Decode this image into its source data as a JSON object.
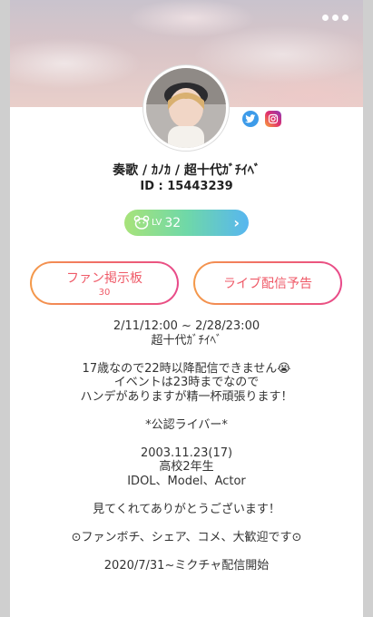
{
  "profile": {
    "name": "奏歌 / ｶﾉｶ / 超十代ｶﾞﾁｲﾍﾞ",
    "id_text": "ID : 15443239",
    "level_prefix": "LV",
    "level_value": "32"
  },
  "buttons": {
    "fan_board_label": "ファン掲示板",
    "fan_board_count": "30",
    "live_schedule_label": "ライブ配信予告"
  },
  "bio_lines": [
    "2/11/12:00 ~ 2/28/23:00",
    "超十代ｶﾞﾁｲﾍﾞ",
    "",
    "17歳なので22時以降配信できません😭",
    "イベントは23時までなので",
    "ハンデがありますが精一杯頑張ります！",
    "",
    "*公認ライバー*",
    "",
    "2003.11.23(17)",
    "高校2年生",
    "IDOL、Model、Actor",
    "",
    "見てくれてありがとうございます！",
    "",
    "⊙ファンボチ、シェア、コメ、大歓迎です⊙",
    "",
    "2020/7/31~ミクチャ配信開始"
  ],
  "icons": {
    "more": "more-dots-icon",
    "twitter": "twitter-icon",
    "instagram": "instagram-icon",
    "bear": "bear-icon",
    "chevron": "chevron-right-icon"
  },
  "colors": {
    "accent_gradient_start": "#f49a4a",
    "accent_gradient_end": "#e84a8a",
    "level_gradient_start": "#a8e37a",
    "level_gradient_end": "#57b6f0"
  }
}
